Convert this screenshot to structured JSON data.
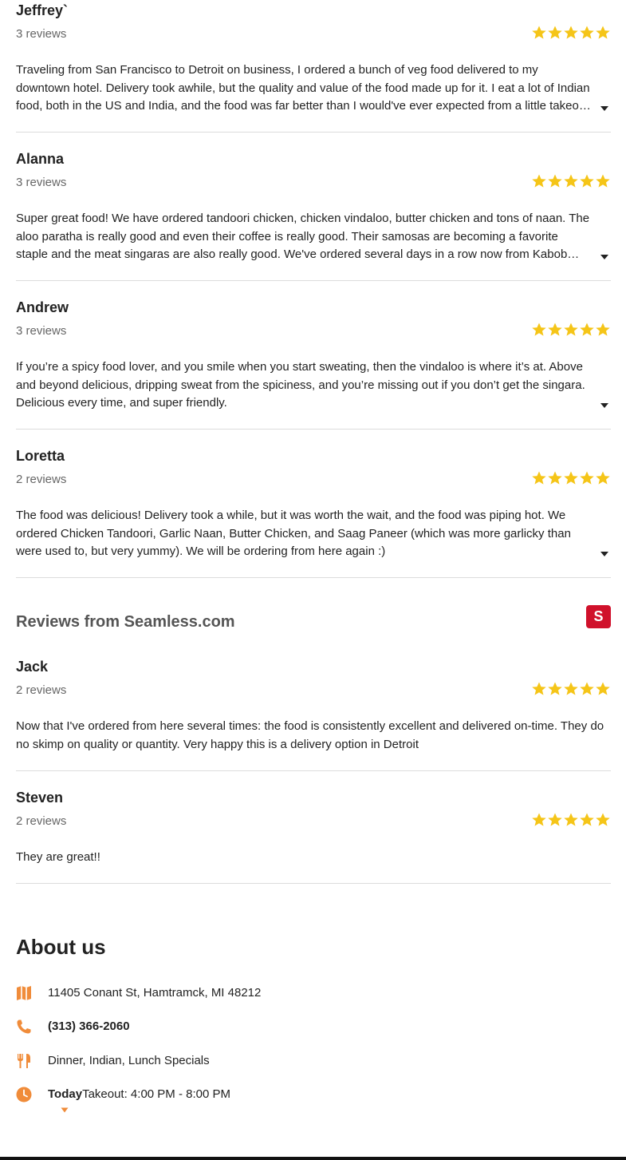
{
  "reviews": [
    {
      "name": "Jeffrey`",
      "count": "3 reviews",
      "rating": 5,
      "text": "Traveling from San Francisco to Detroit on business, I ordered a bunch of veg food delivered to my downtown hotel. Delivery took awhile, but the quality and value of the food made up for it. I eat a lot of Indian food, both in the US and India, and the food was far better than I would've ever expected from a little takeout place."
    },
    {
      "name": "Alanna",
      "count": "3 reviews",
      "rating": 5,
      "text": "Super great food! We have ordered tandoori chicken, chicken vindaloo, butter chicken and tons of naan. The aloo paratha is really good and even their coffee is really good. Their samosas are becoming a favorite staple and the meat singaras are also really good. We've ordered several days in a row now from Kabob House and love it."
    },
    {
      "name": "Andrew",
      "count": "3 reviews",
      "rating": 5,
      "text": "If you’re a spicy food lover, and you smile when you start sweating, then the vindaloo is where it’s at. Above and beyond delicious, dripping sweat from the spiciness, and you’re missing out if you don’t get the singara. Delicious every time, and super friendly."
    },
    {
      "name": "Loretta",
      "count": "2 reviews",
      "rating": 5,
      "text": "The food was delicious! Delivery took a while, but it was worth the wait, and the food was piping hot. We ordered Chicken Tandoori, Garlic Naan, Butter Chicken, and Saag Paneer (which was more garlicky than were used to, but very yummy). We will be ordering from here again :)"
    }
  ],
  "seamless": {
    "title": "Reviews from Seamless.com",
    "logo_letter": "S",
    "logo_color": "#d0112b",
    "reviews": [
      {
        "name": "Jack",
        "count": "2 reviews",
        "rating": 5,
        "text": "Now that I've ordered from here several times: the food is consistently excellent and delivered on-time. They do no skimp on quality or quantity. Very happy this is a delivery option in Detroit"
      },
      {
        "name": "Steven",
        "count": "2 reviews",
        "rating": 5,
        "text": "They are great!!"
      }
    ]
  },
  "about": {
    "title": "About us",
    "address": "11405 Conant St, Hamtramck, MI 48212",
    "phone": "(313) 366-2060",
    "cuisine": "Dinner, Indian, Lunch Specials",
    "hours_day": "Today",
    "hours_text": "Takeout: 4:00 PM - 8:00 PM",
    "icons": [
      "map-icon",
      "phone-icon",
      "fork-knife-icon",
      "clock-icon"
    ]
  },
  "colors": {
    "star": "#f5c518",
    "accent": "#f08c3a",
    "divider": "#dcdcdc"
  }
}
